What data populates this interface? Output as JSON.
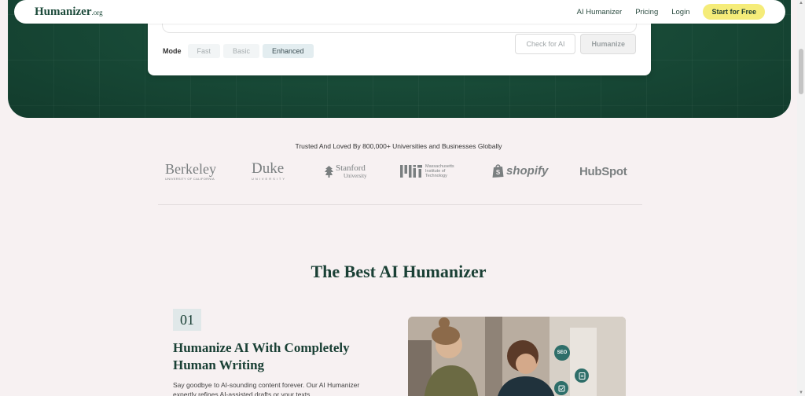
{
  "nav": {
    "logo_main": "Humanizer",
    "logo_tld": ".org",
    "links": [
      "AI Humanizer",
      "Pricing",
      "Login"
    ],
    "cta": "Start for Free"
  },
  "editor": {
    "mode_label": "Mode",
    "modes": [
      "Fast",
      "Basic",
      "Enhanced"
    ],
    "selected_mode": "Enhanced",
    "check_button": "Check for AI",
    "humanize_button": "Humanize"
  },
  "trusted": {
    "text": "Trusted And Loved By 800,000+ Universities and Businesses Globally",
    "logos": {
      "berkeley": "Berkeley",
      "berkeley_sub": "UNIVERSITY OF CALIFORNIA",
      "duke": "Duke",
      "duke_sub": "UNIVERSITY",
      "stanford": "Stanford",
      "stanford_sub": "University",
      "mit_name": "Massachusetts Institute of Technology",
      "shopify": "shopify",
      "hubspot": "HubSpot"
    }
  },
  "section": {
    "title": "The Best AI Humanizer",
    "feature_number": "01",
    "feature_title": "Humanize AI With Completely Human Writing",
    "feature_desc": "Say goodbye to AI-sounding content forever. Our AI Humanizer expertly refines AI-assisted drafts or your texts."
  },
  "photo_badges": [
    "SEO"
  ],
  "colors": {
    "brand_dark_green": "#1a4035",
    "hero_green": "#184a37",
    "cta_yellow": "#f5ec79",
    "page_bg": "#f7f1f2"
  }
}
